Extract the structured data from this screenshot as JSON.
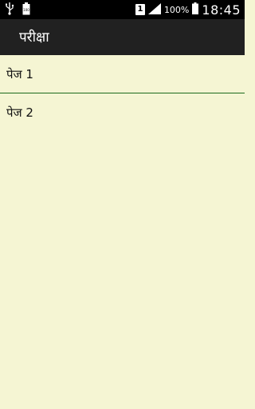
{
  "status_bar": {
    "sim_number": "1",
    "battery_percent": "100%",
    "time": "18:45",
    "icons": [
      "usb-icon",
      "battery-full-notification-icon",
      "sim-icon",
      "signal-icon",
      "battery-icon"
    ]
  },
  "app_bar": {
    "title": "परीक्षा"
  },
  "list": {
    "items": [
      {
        "label": "पेज 1"
      },
      {
        "label": "पेज 2"
      }
    ],
    "divider_color": "#1c6a1c"
  },
  "colors": {
    "background": "#f5f5d3",
    "app_bar": "#212121",
    "status_bar": "#000000"
  }
}
